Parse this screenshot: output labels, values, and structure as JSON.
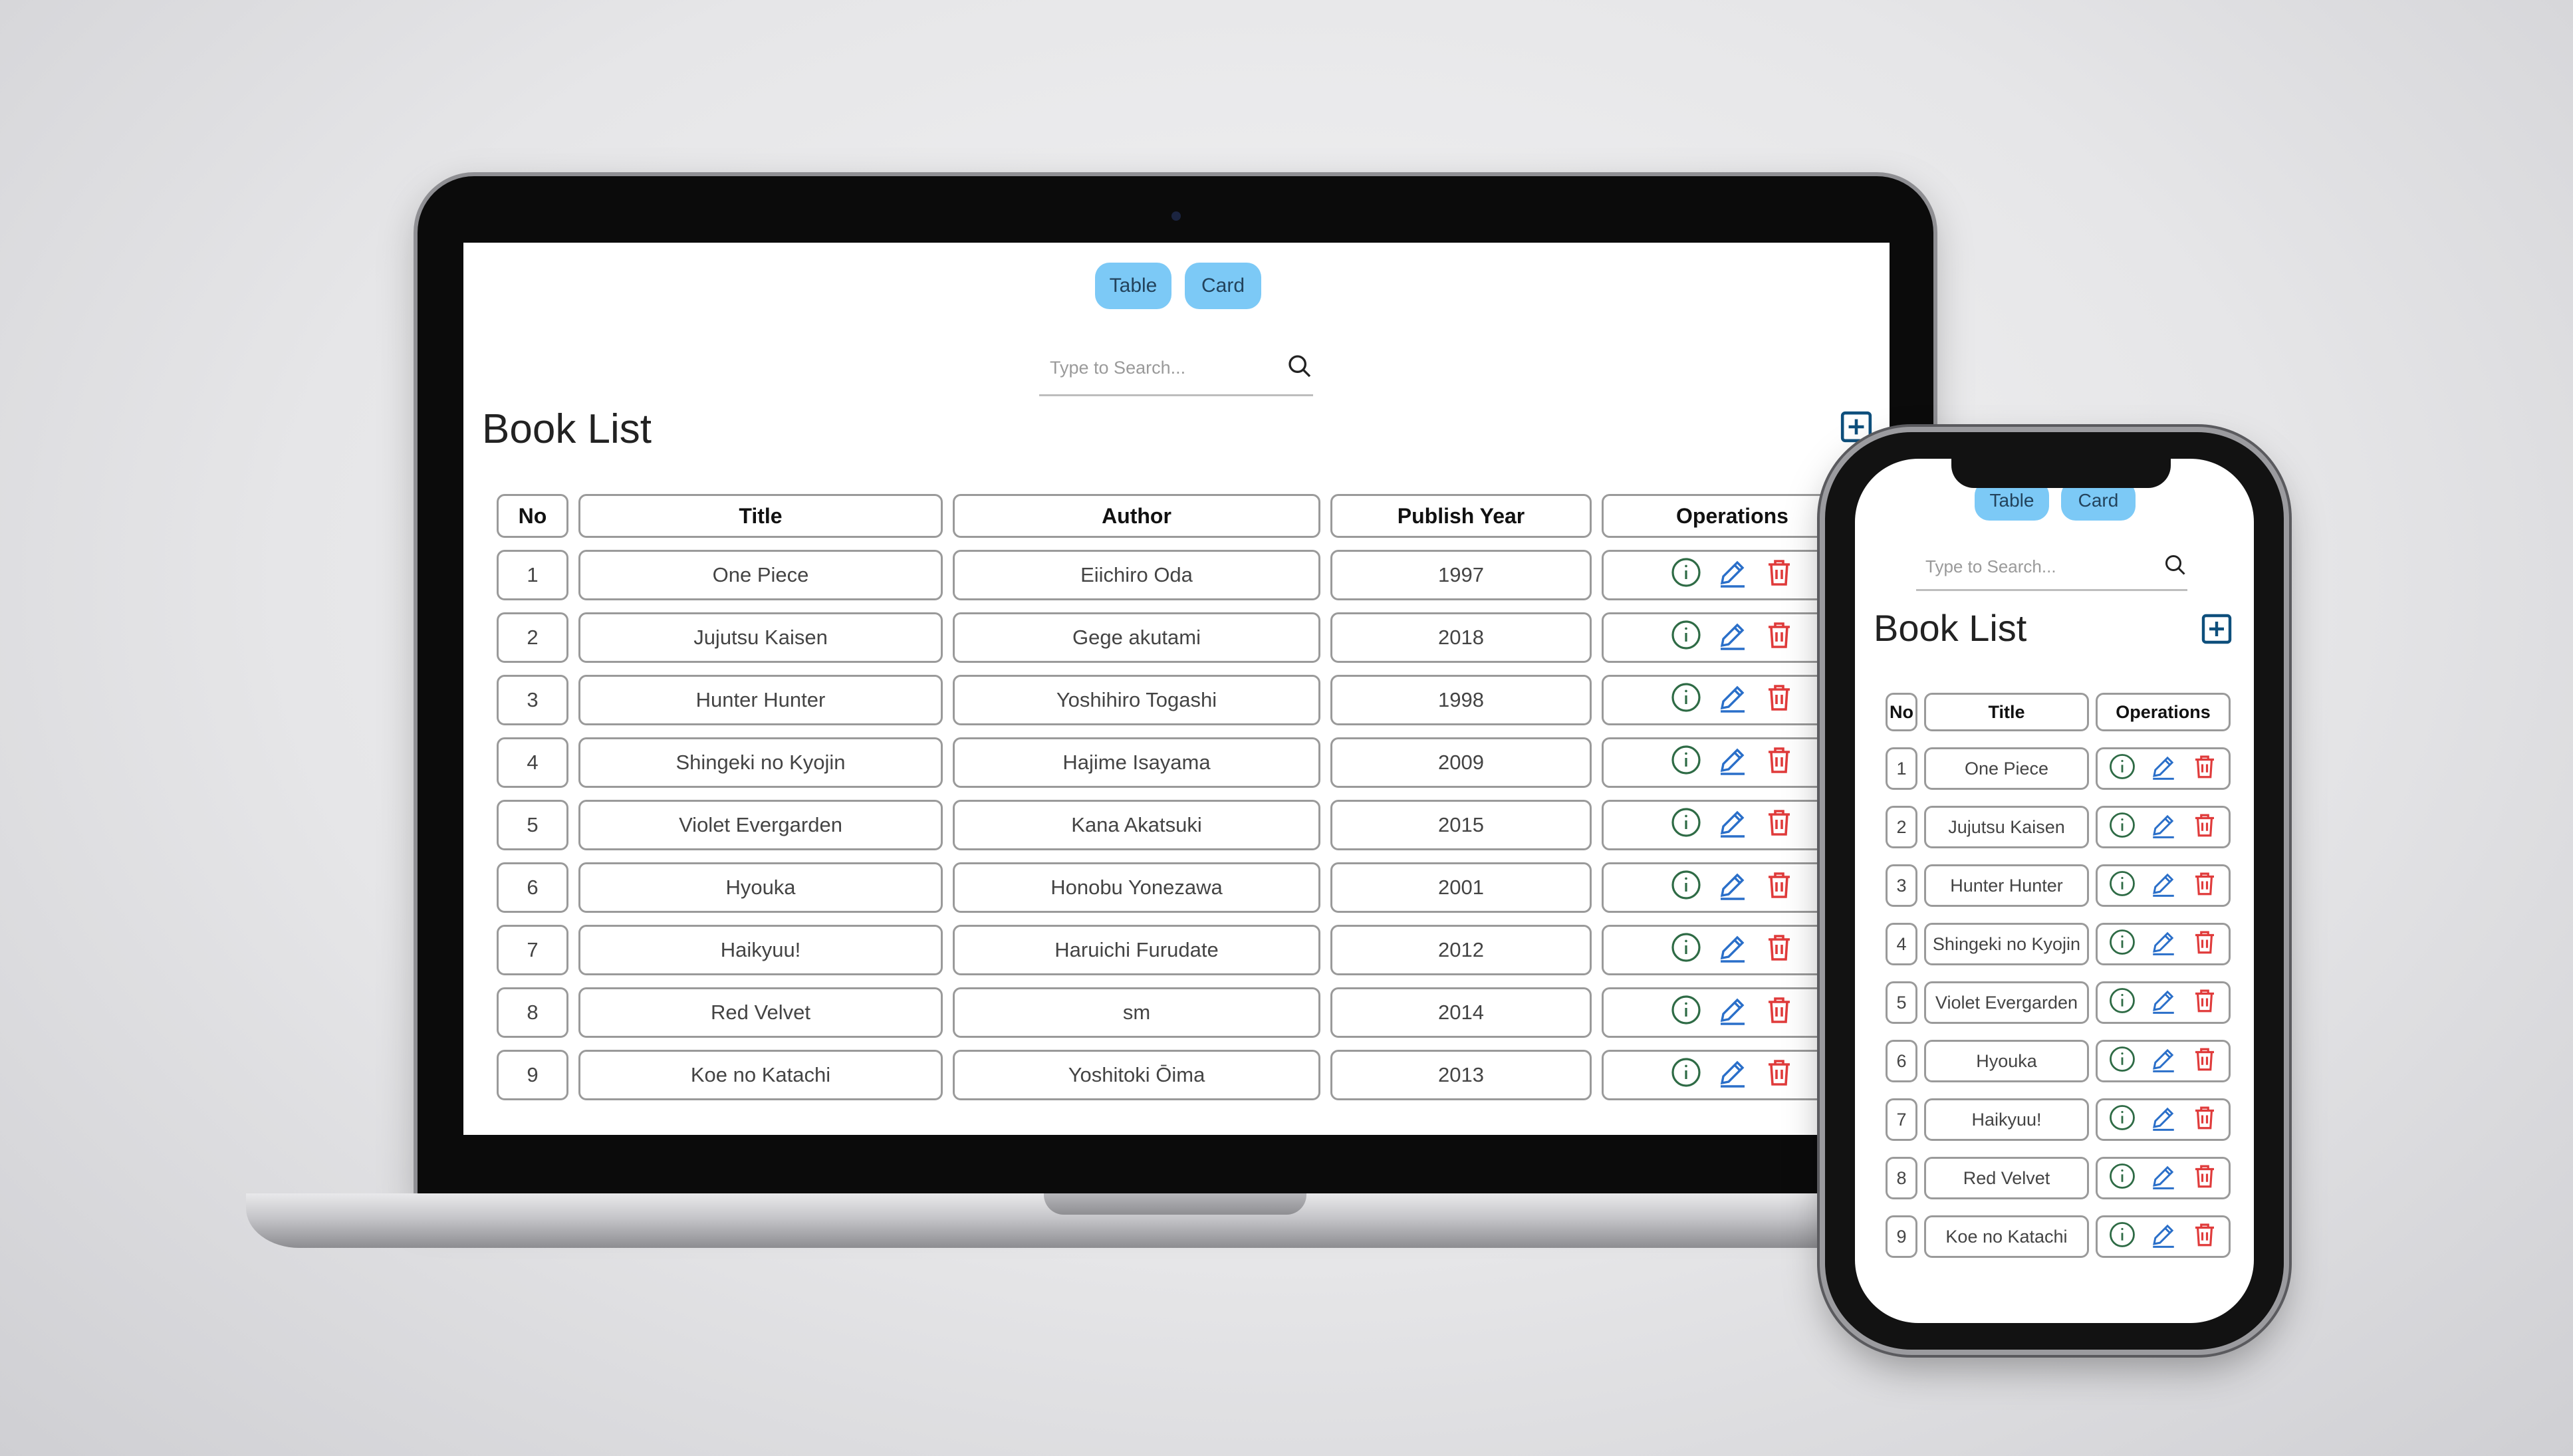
{
  "view_toggle": {
    "table_label": "Table",
    "card_label": "Card"
  },
  "search": {
    "placeholder": "Type to Search..."
  },
  "page_title": "Book List",
  "columns": {
    "no": "No",
    "title": "Title",
    "author": "Author",
    "year": "Publish Year",
    "operations": "Operations"
  },
  "books": [
    {
      "no": "1",
      "title": "One Piece",
      "author": "Eiichiro Oda",
      "year": "1997"
    },
    {
      "no": "2",
      "title": "Jujutsu Kaisen",
      "author": "Gege akutami",
      "year": "2018"
    },
    {
      "no": "3",
      "title": "Hunter Hunter",
      "author": "Yoshihiro Togashi",
      "year": "1998"
    },
    {
      "no": "4",
      "title": "Shingeki no Kyojin",
      "author": "Hajime Isayama",
      "year": "2009"
    },
    {
      "no": "5",
      "title": "Violet Evergarden",
      "author": "Kana Akatsuki",
      "year": "2015"
    },
    {
      "no": "6",
      "title": "Hyouka",
      "author": "Honobu Yonezawa",
      "year": "2001"
    },
    {
      "no": "7",
      "title": "Haikyuu!",
      "author": "Haruichi Furudate",
      "year": "2012"
    },
    {
      "no": "8",
      "title": "Red Velvet",
      "author": "sm",
      "year": "2014"
    },
    {
      "no": "9",
      "title": "Koe no Katachi",
      "author": "Yoshitoki Ōima",
      "year": "2013"
    }
  ],
  "icons": {
    "info": "info-circle-icon",
    "edit": "pencil-icon",
    "delete": "trash-icon",
    "search": "search-icon",
    "add": "plus-square-icon"
  },
  "colors": {
    "toggle_bg": "#7cc9f6",
    "info": "#2e6b45",
    "edit": "#2a6fc9",
    "delete": "#e03b3b",
    "add": "#0e4f7c"
  }
}
